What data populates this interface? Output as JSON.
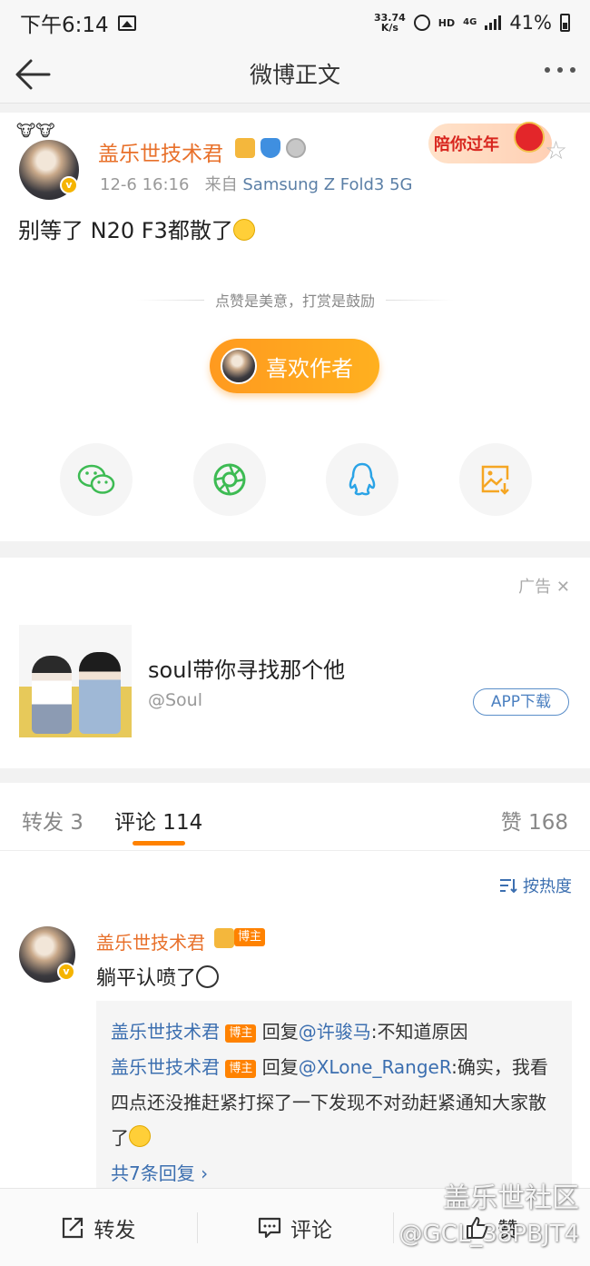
{
  "status_bar": {
    "time": "下午6:14",
    "speed_value": "33.74",
    "speed_unit": "K/s",
    "hd": "HD",
    "network": "4G",
    "battery": "41%"
  },
  "nav": {
    "title": "微博正文"
  },
  "post": {
    "author": "盖乐世技术君",
    "timestamp": "12-6 16:16",
    "source_prefix": "来自",
    "device": "Samsung Z Fold3 5G",
    "banner": "陪你过年",
    "text": "别等了 N20 F3都散了",
    "reward_hint": "点赞是美意，打赏是鼓励",
    "like_author": "喜欢作者"
  },
  "share": [
    "wechat-icon",
    "moments-icon",
    "qq-icon",
    "save-image-icon"
  ],
  "ad": {
    "tag": "广告",
    "headline": "soul带你寻找那个他",
    "handle": "@Soul",
    "button": "APP下载"
  },
  "tabs": {
    "repost": "转发 3",
    "comments": "评论 114",
    "likes": "赞 168"
  },
  "sort_label": "按热度",
  "comment": {
    "author": "盖乐世技术君",
    "host_badge": "博主",
    "text": "躺平认喷了",
    "replies": [
      {
        "author": "盖乐世技术君",
        "badge": "博主",
        "verb": "回复",
        "target": "@许骏马",
        "text": ":不知道原因"
      },
      {
        "author": "盖乐世技术君",
        "badge": "博主",
        "verb": "回复",
        "target": "@XLone_RangeR",
        "text": ":确实，我看四点还没推赶紧打探了一下发现不对劲赶紧通知大家散了"
      }
    ],
    "more_replies": "共7条回复 ›"
  },
  "bottom_bar": {
    "repost": "转发",
    "comment": "评论",
    "like": "赞"
  },
  "watermark": {
    "line1": "盖乐世社区",
    "line2": "@GCL_38PBJT4"
  },
  "colors": {
    "accent": "#ff8200",
    "link": "#3c6fb0",
    "name": "#e8702a"
  }
}
